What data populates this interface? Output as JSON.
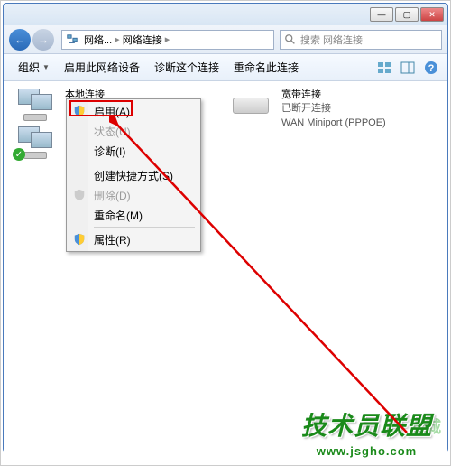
{
  "titlebar": {
    "min": "—",
    "max": "▢",
    "close": "✕"
  },
  "nav": {
    "back": "←",
    "forward": "→",
    "crumb1": "网络...",
    "crumb2": "网络连接",
    "crumb_sep": "▸",
    "search_placeholder": "搜索 网络连接"
  },
  "toolbar": {
    "organize": "组织",
    "enable_device": "启用此网络设备",
    "diagnose": "诊断这个连接",
    "rename": "重命名此连接"
  },
  "connections": [
    {
      "name": "本地连接",
      "status": "",
      "device": ""
    },
    {
      "name": "宽带连接",
      "status": "已断开连接",
      "device": "WAN Miniport (PPPOE)"
    }
  ],
  "context_menu": {
    "items": [
      {
        "label": "启用(A)",
        "enabled": true,
        "icon": "shield"
      },
      {
        "label": "状态(U)",
        "enabled": false
      },
      {
        "label": "诊断(I)",
        "enabled": true
      },
      {
        "sep": true
      },
      {
        "label": "创建快捷方式(S)",
        "enabled": true
      },
      {
        "label": "删除(D)",
        "enabled": false,
        "icon": "shield"
      },
      {
        "label": "重命名(M)",
        "enabled": true
      },
      {
        "sep": true
      },
      {
        "label": "属性(R)",
        "enabled": true,
        "icon": "shield"
      }
    ]
  },
  "watermark": {
    "text": "技术员联盟",
    "url": "www.jsgho.com",
    "overlay": "光城"
  }
}
